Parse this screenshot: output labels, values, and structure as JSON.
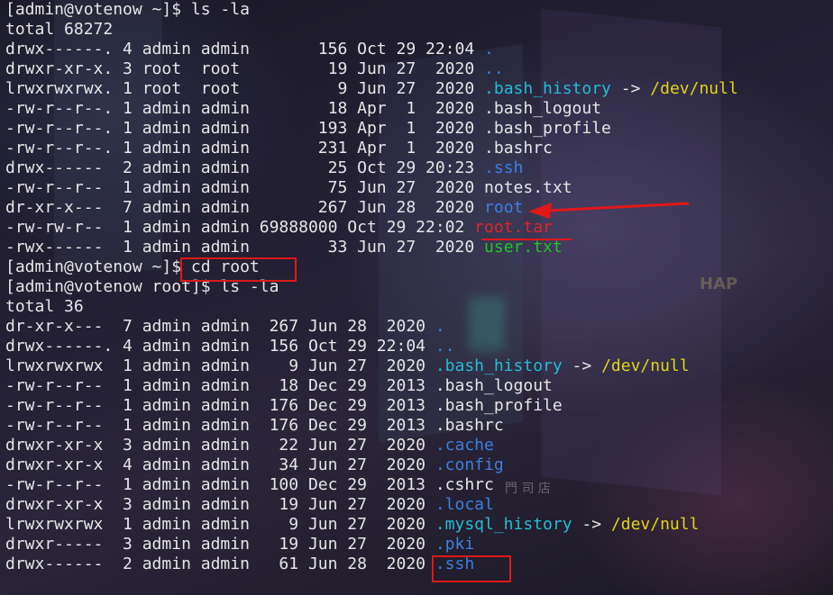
{
  "terminal": {
    "lines": [
      {
        "text": "[admin@votenow ~]$ ls -la"
      },
      {
        "text": "total 68272"
      },
      {
        "prefix": "drwx------. 4 admin admin       156 Oct 29 22:04 ",
        "name": ".",
        "color": "blue"
      },
      {
        "prefix": "drwxr-xr-x. 3 root  root         19 Jun 27  2020 ",
        "name": "..",
        "color": "blue"
      },
      {
        "prefix": "lrwxrwxrwx. 1 root  root          9 Jun 27  2020 ",
        "name": ".bash_history",
        "color": "cyan",
        "arrow": " -> ",
        "target": "/dev/null",
        "target_color": "yellow"
      },
      {
        "prefix": "-rw-r--r--. 1 admin admin        18 Apr  1  2020 ",
        "name": ".bash_logout",
        "color": "white"
      },
      {
        "prefix": "-rw-r--r--. 1 admin admin       193 Apr  1  2020 ",
        "name": ".bash_profile",
        "color": "white"
      },
      {
        "prefix": "-rw-r--r--. 1 admin admin       231 Apr  1  2020 ",
        "name": ".bashrc",
        "color": "white"
      },
      {
        "prefix": "drwx------  2 admin admin        25 Oct 29 20:23 ",
        "name": ".ssh",
        "color": "blue"
      },
      {
        "prefix": "-rw-r--r--  1 admin admin        75 Jun 27  2020 ",
        "name": "notes.txt",
        "color": "white"
      },
      {
        "prefix": "dr-xr-x---  7 admin admin       267 Jun 28  2020 ",
        "name": "root",
        "color": "blue"
      },
      {
        "prefix": "-rw-rw-r--  1 admin admin 69888000 Oct 29 22:02 ",
        "name": "root.tar",
        "color": "red"
      },
      {
        "prefix": "-rwx------  1 admin admin        33 Jun 27  2020 ",
        "name": "user.txt",
        "color": "green"
      },
      {
        "text": "[admin@votenow ~]$ cd root"
      },
      {
        "text": "[admin@votenow root]$ ls -la"
      },
      {
        "text": "total 36"
      },
      {
        "prefix": "dr-xr-x---  7 admin admin  267 Jun 28  2020 ",
        "name": ".",
        "color": "blue"
      },
      {
        "prefix": "drwx------. 4 admin admin  156 Oct 29 22:04 ",
        "name": "..",
        "color": "blue"
      },
      {
        "prefix": "lrwxrwxrwx  1 admin admin    9 Jun 27  2020 ",
        "name": ".bash_history",
        "color": "cyan",
        "arrow": " -> ",
        "target": "/dev/null",
        "target_color": "yellow"
      },
      {
        "prefix": "-rw-r--r--  1 admin admin   18 Dec 29  2013 ",
        "name": ".bash_logout",
        "color": "white"
      },
      {
        "prefix": "-rw-r--r--  1 admin admin  176 Dec 29  2013 ",
        "name": ".bash_profile",
        "color": "white"
      },
      {
        "prefix": "-rw-r--r--  1 admin admin  176 Dec 29  2013 ",
        "name": ".bashrc",
        "color": "white"
      },
      {
        "prefix": "drwxr-xr-x  3 admin admin   22 Jun 27  2020 ",
        "name": ".cache",
        "color": "blue"
      },
      {
        "prefix": "drwxr-xr-x  4 admin admin   34 Jun 27  2020 ",
        "name": ".config",
        "color": "blue"
      },
      {
        "prefix": "-rw-r--r--  1 admin admin  100 Dec 29  2013 ",
        "name": ".cshrc",
        "color": "white"
      },
      {
        "prefix": "drwxr-xr-x  3 admin admin   19 Jun 27  2020 ",
        "name": ".local",
        "color": "blue"
      },
      {
        "prefix": "lrwxrwxrwx  1 admin admin    9 Jun 27  2020 ",
        "name": ".mysql_history",
        "color": "cyan",
        "arrow": " -> ",
        "target": "/dev/null",
        "target_color": "yellow"
      },
      {
        "prefix": "drwxr-----  3 admin admin   19 Jun 27  2020 ",
        "name": ".pki",
        "color": "blue"
      },
      {
        "prefix": "drwx------  2 admin admin   61 Jun 28  2020 ",
        "name": ".ssh",
        "color": "blue"
      }
    ]
  },
  "background_signs": {
    "sign_hap": "HAP",
    "sign_kanji": "門 司 店"
  },
  "colors": {
    "blue": "#3d7fe0",
    "cyan": "#24bcd6",
    "yellow": "#e2d31a",
    "green": "#22c328",
    "red": "#e0242a",
    "annotation": "#e01818"
  }
}
